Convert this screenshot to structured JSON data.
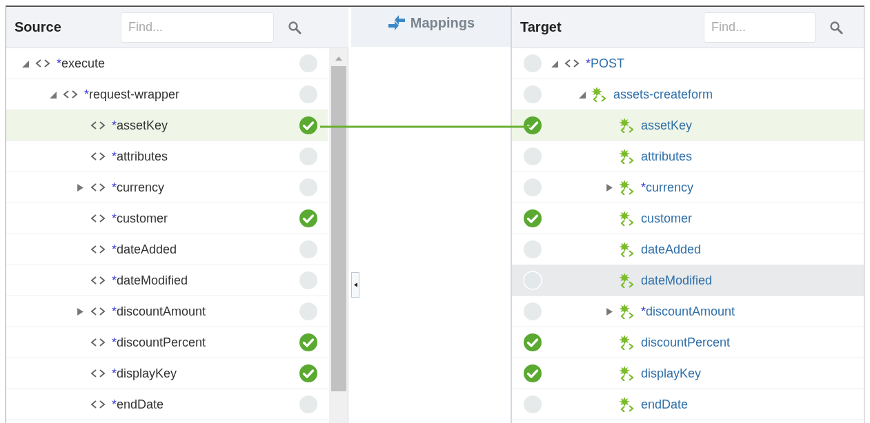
{
  "source": {
    "title": "Source",
    "search": {
      "placeholder": "Find..."
    },
    "tree": [
      {
        "marker": "*",
        "name": "execute",
        "kind": "element",
        "mapped": false,
        "selected": false,
        "hovered": false,
        "expanded": true,
        "children": [
          {
            "marker": "*",
            "name": "request-wrapper",
            "kind": "element",
            "mapped": false,
            "selected": false,
            "hovered": false,
            "expanded": true,
            "children": [
              {
                "marker": "*",
                "name": "assetKey",
                "kind": "element",
                "mapped": true,
                "selected": true,
                "hovered": false
              },
              {
                "marker": "*",
                "name": "attributes",
                "kind": "element",
                "mapped": false,
                "selected": false,
                "hovered": false
              },
              {
                "marker": "*",
                "name": "currency",
                "kind": "element",
                "mapped": false,
                "selected": false,
                "hovered": false,
                "expanded": false
              },
              {
                "marker": "*",
                "name": "customer",
                "kind": "element",
                "mapped": true,
                "selected": false,
                "hovered": false
              },
              {
                "marker": "*",
                "name": "dateAdded",
                "kind": "element",
                "mapped": false,
                "selected": false,
                "hovered": false
              },
              {
                "marker": "*",
                "name": "dateModified",
                "kind": "element",
                "mapped": false,
                "selected": false,
                "hovered": false
              },
              {
                "marker": "*",
                "name": "discountAmount",
                "kind": "element",
                "mapped": false,
                "selected": false,
                "hovered": false,
                "expanded": false
              },
              {
                "marker": "*",
                "name": "discountPercent",
                "kind": "element",
                "mapped": true,
                "selected": false,
                "hovered": false
              },
              {
                "marker": "*",
                "name": "displayKey",
                "kind": "element",
                "mapped": true,
                "selected": false,
                "hovered": false
              },
              {
                "marker": "*",
                "name": "endDate",
                "kind": "element",
                "mapped": false,
                "selected": false,
                "hovered": false
              }
            ]
          }
        ]
      }
    ]
  },
  "mappings": {
    "title": "Mappings"
  },
  "target": {
    "title": "Target",
    "search": {
      "placeholder": "Find..."
    },
    "tree": [
      {
        "marker": "*",
        "name": "POST",
        "kind": "element",
        "mapped": false,
        "selected": false,
        "hovered": false,
        "expanded": true,
        "children": [
          {
            "name": "assets-createform",
            "kind": "json",
            "mapped": false,
            "selected": false,
            "hovered": false,
            "expanded": true,
            "children": [
              {
                "name": "assetKey",
                "kind": "json",
                "mapped": true,
                "selected": true,
                "hovered": false
              },
              {
                "name": "attributes",
                "kind": "json",
                "mapped": false,
                "selected": false,
                "hovered": false
              },
              {
                "marker": "*",
                "name": "currency",
                "kind": "json",
                "mapped": false,
                "selected": false,
                "hovered": false,
                "expanded": false
              },
              {
                "name": "customer",
                "kind": "json",
                "mapped": true,
                "selected": false,
                "hovered": false
              },
              {
                "name": "dateAdded",
                "kind": "json",
                "mapped": false,
                "selected": false,
                "hovered": false
              },
              {
                "name": "dateModified",
                "kind": "json",
                "mapped": false,
                "selected": false,
                "hovered": true
              },
              {
                "marker": "*",
                "name": "discountAmount",
                "kind": "json",
                "mapped": false,
                "selected": false,
                "hovered": false,
                "expanded": false
              },
              {
                "name": "discountPercent",
                "kind": "json",
                "mapped": true,
                "selected": false,
                "hovered": false
              },
              {
                "name": "displayKey",
                "kind": "json",
                "mapped": true,
                "selected": false,
                "hovered": false
              },
              {
                "name": "endDate",
                "kind": "json",
                "mapped": false,
                "selected": false,
                "hovered": false
              }
            ]
          }
        ]
      }
    ]
  }
}
